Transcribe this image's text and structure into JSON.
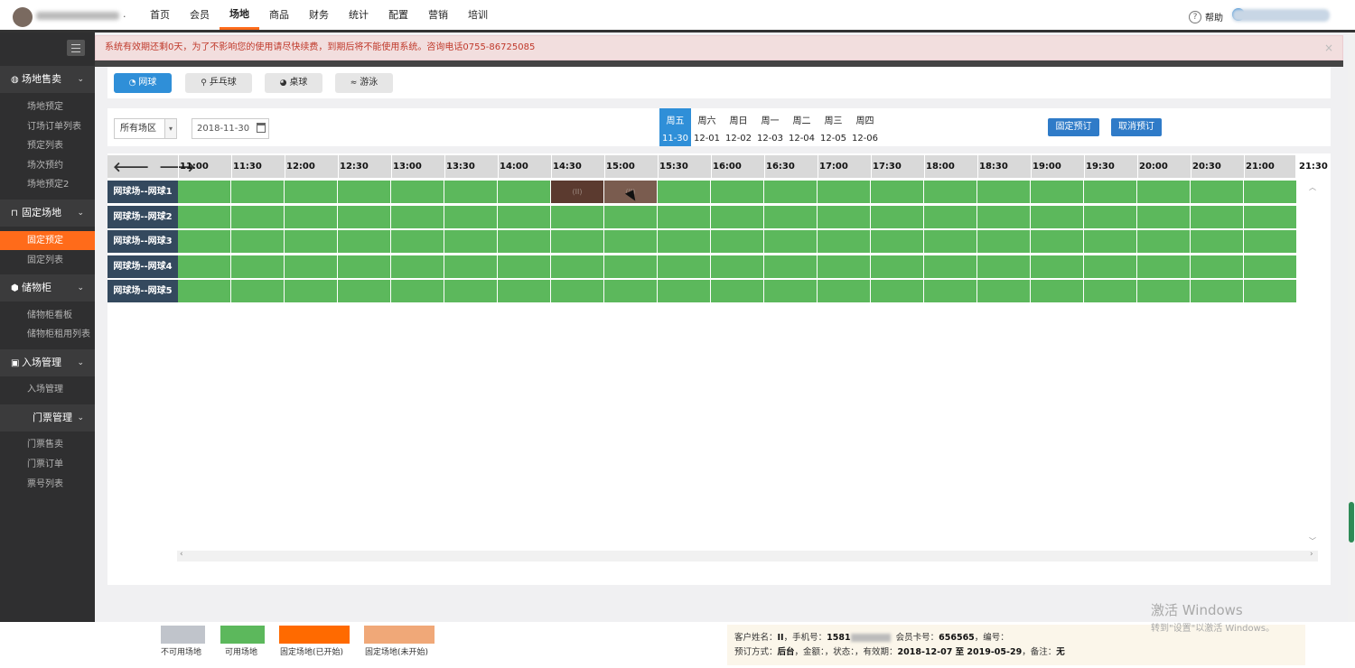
{
  "topbar": {
    "nav": [
      "首页",
      "会员",
      "场地",
      "商品",
      "财务",
      "统计",
      "配置",
      "营销",
      "培训"
    ],
    "active_nav": "场地",
    "help_label": "帮助",
    "separator": "·"
  },
  "sidebar": {
    "groups": [
      {
        "label": "场地售卖",
        "icon": "globe-icon",
        "items": [
          "场地预定",
          "订场订单列表",
          "预定列表",
          "场次预约",
          "场地预定2"
        ]
      },
      {
        "label": "固定场地",
        "icon": "bookmark-icon",
        "items": [
          "固定预定",
          "固定列表"
        ]
      },
      {
        "label": "储物柜",
        "icon": "cube-icon",
        "items": [
          "储物柜看板",
          "储物柜租用列表"
        ]
      },
      {
        "label": "入场管理",
        "icon": "idcard-icon",
        "items": [
          "入场管理"
        ]
      },
      {
        "label": "门票管理",
        "icon": "",
        "items": [
          "门票售卖",
          "门票订单",
          "票号列表"
        ]
      }
    ],
    "active_item": "固定预定"
  },
  "alert": {
    "text": "系统有效期还剩0天，为了不影响您的使用请尽快续费，到期后将不能使用系统。咨询电话0755-86725085",
    "close": "×"
  },
  "sports": [
    {
      "label": "网球",
      "icon": "tennis-icon",
      "active": true
    },
    {
      "label": "乒乓球",
      "icon": "pingpong-icon",
      "active": false
    },
    {
      "label": "桌球",
      "icon": "billiards-icon",
      "active": false
    },
    {
      "label": "游泳",
      "icon": "swim-icon",
      "active": false
    }
  ],
  "filters": {
    "area_value": "所有场区",
    "date_value": "2018-11-30"
  },
  "days": [
    {
      "week": "周五",
      "date": "11-30",
      "active": true
    },
    {
      "week": "周六",
      "date": "12-01",
      "active": false
    },
    {
      "week": "周日",
      "date": "12-02",
      "active": false
    },
    {
      "week": "周一",
      "date": "12-03",
      "active": false
    },
    {
      "week": "周二",
      "date": "12-04",
      "active": false
    },
    {
      "week": "周三",
      "date": "12-05",
      "active": false
    },
    {
      "week": "周四",
      "date": "12-06",
      "active": false
    }
  ],
  "actions": {
    "fixed_book": "固定预订",
    "cancel_book": "取消预订"
  },
  "times": [
    "11:00",
    "11:30",
    "12:00",
    "12:30",
    "13:00",
    "13:30",
    "14:00",
    "14:30",
    "15:00",
    "15:30",
    "16:00",
    "16:30",
    "17:00",
    "17:30",
    "18:00",
    "18:30",
    "19:00",
    "19:30",
    "20:00",
    "20:30",
    "21:00",
    "21:30"
  ],
  "courts": [
    "网球场--网球1",
    "网球场--网球2",
    "网球场--网球3",
    "网球场--网球4",
    "网球场--网球5"
  ],
  "booked": [
    {
      "court": 0,
      "slot": 7,
      "label": "(II)"
    },
    {
      "court": 0,
      "slot": 8,
      "label": "(II)"
    }
  ],
  "legend": [
    {
      "label": "不可用场地",
      "color": "#c0c4cb"
    },
    {
      "label": "可用场地",
      "color": "#5cb85c"
    },
    {
      "label": "固定场地(已开始)",
      "color": "#ff6a00"
    },
    {
      "label": "固定场地(未开始)",
      "color": "#f0a878"
    }
  ],
  "info": {
    "line1_prefix": "客户姓名：",
    "name": "II",
    "phone_label": "，手机号：",
    "phone": "1581",
    "card_label": "会员卡号：",
    "card": "656565",
    "no_label": "，编号：",
    "line2_prefix": "预订方式：",
    "method": "后台",
    "amount_label": "，金额：，状态：，有效期：",
    "period": "2018-12-07 至 2019-05-29",
    "remark_label": "，备注：",
    "remark": "无"
  },
  "watermark": {
    "title": "激活 Windows",
    "sub": "转到\"设置\"以激活 Windows。"
  }
}
